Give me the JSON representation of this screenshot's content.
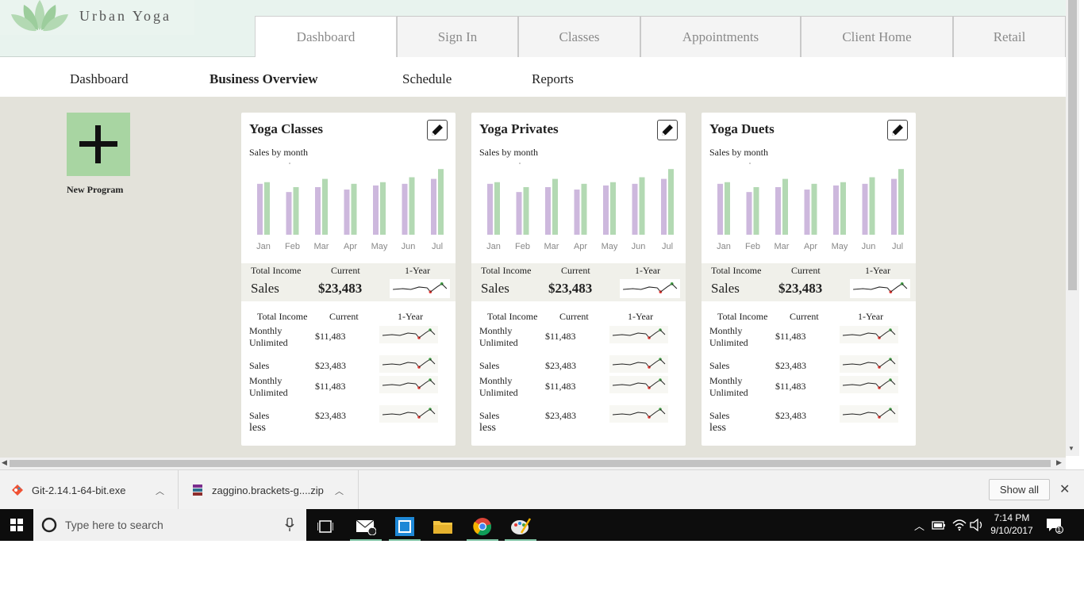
{
  "brand": {
    "name": "Urban Yoga"
  },
  "main_tabs": [
    {
      "label": "Dashboard",
      "active": true
    },
    {
      "label": "Sign In"
    },
    {
      "label": "Classes"
    },
    {
      "label": "Appointments"
    },
    {
      "label": "Client Home"
    },
    {
      "label": "Retail"
    }
  ],
  "sub_nav": [
    {
      "label": "Dashboard"
    },
    {
      "label": "Business Overview",
      "active": true
    },
    {
      "label": "Schedule"
    },
    {
      "label": "Reports"
    }
  ],
  "new_program": {
    "label": "New Program"
  },
  "cards": [
    {
      "title": "Yoga Classes",
      "chart_label": "Sales by month",
      "summary": {
        "col1": "Total Income",
        "col2": "Current",
        "col3": "1-Year",
        "label": "Sales",
        "value": "$23,483"
      },
      "detail_headers": {
        "col1": "Total Income",
        "col2": "Current",
        "col3": "1-Year"
      },
      "rows": [
        {
          "label": "Monthly Unlimited",
          "value": "$11,483"
        },
        {
          "label": "Sales",
          "value": "$23,483"
        },
        {
          "label": "Monthly Unlimited",
          "value": "$11,483"
        },
        {
          "label": "Sales",
          "value": "$23,483"
        }
      ],
      "less": "less"
    },
    {
      "title": "Yoga Privates",
      "chart_label": "Sales by month",
      "summary": {
        "col1": "Total Income",
        "col2": "Current",
        "col3": "1-Year",
        "label": "Sales",
        "value": "$23,483"
      },
      "detail_headers": {
        "col1": "Total Income",
        "col2": "Current",
        "col3": "1-Year"
      },
      "rows": [
        {
          "label": "Monthly Unlimited",
          "value": "$11,483"
        },
        {
          "label": "Sales",
          "value": "$23,483"
        },
        {
          "label": "Monthly Unlimited",
          "value": "$11,483"
        },
        {
          "label": "Sales",
          "value": "$23,483"
        }
      ],
      "less": "less"
    },
    {
      "title": "Yoga Duets",
      "chart_label": "Sales by month",
      "summary": {
        "col1": "Total Income",
        "col2": "Current",
        "col3": "1-Year",
        "label": "Sales",
        "value": "$23,483"
      },
      "detail_headers": {
        "col1": "Total Income",
        "col2": "Current",
        "col3": "1-Year"
      },
      "rows": [
        {
          "label": "Monthly Unlimited",
          "value": "$11,483"
        },
        {
          "label": "Sales",
          "value": "$23,483"
        },
        {
          "label": "Monthly Unlimited",
          "value": "$11,483"
        },
        {
          "label": "Sales",
          "value": "$23,483"
        }
      ],
      "less": "less"
    }
  ],
  "chart_data": {
    "type": "bar",
    "categories": [
      "Jan",
      "Feb",
      "Mar",
      "Apr",
      "May",
      "Jun",
      "Jul"
    ],
    "series": [
      {
        "values": [
          62,
          52,
          58,
          55,
          60,
          62,
          68
        ],
        "color": "#cdb8dd"
      },
      {
        "values": [
          64,
          58,
          68,
          62,
          64,
          70,
          80
        ],
        "color": "#b3d9b3"
      }
    ],
    "ylim": [
      0,
      85
    ]
  },
  "downloads": {
    "items": [
      {
        "name": "Git-2.14.1-64-bit.exe"
      },
      {
        "name": "zaggino.brackets-g....zip"
      }
    ],
    "show_all": "Show all"
  },
  "taskbar": {
    "search_placeholder": "Type here to search",
    "time": "7:14 PM",
    "date": "9/10/2017",
    "mail_badge": "1",
    "notif_badge": "1"
  },
  "colors": {
    "accent_green": "#a8d5a2",
    "header_bg": "#e8f3ee",
    "content_bg": "#e3e2da",
    "bar_purple": "#cdb8dd",
    "bar_green": "#b3d9b3"
  }
}
